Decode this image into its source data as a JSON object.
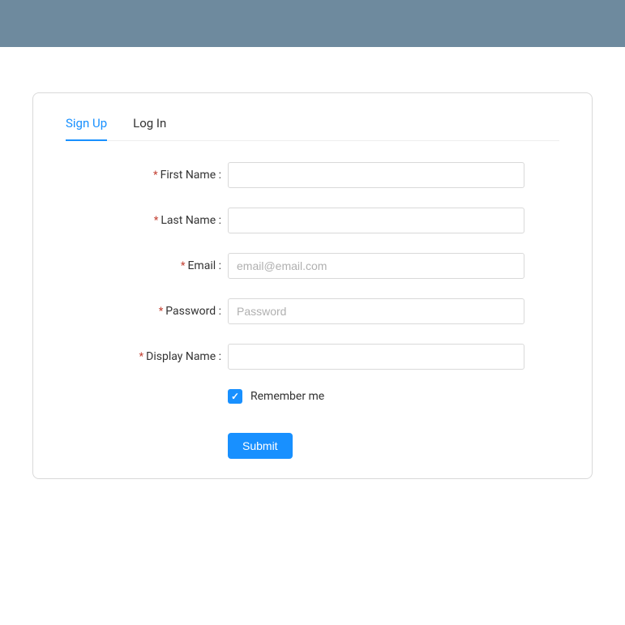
{
  "tabs": {
    "signup": "Sign Up",
    "login": "Log In"
  },
  "form": {
    "first_name_label": "First Name :",
    "first_name_value": "",
    "last_name_label": "Last Name :",
    "last_name_value": "",
    "email_label": "Email :",
    "email_placeholder": "email@email.com",
    "email_value": "",
    "password_label": "Password :",
    "password_placeholder": "Password",
    "password_value": "",
    "display_name_label": "Display Name :",
    "display_name_value": "",
    "remember_label": "Remember me",
    "submit_label": "Submit"
  }
}
